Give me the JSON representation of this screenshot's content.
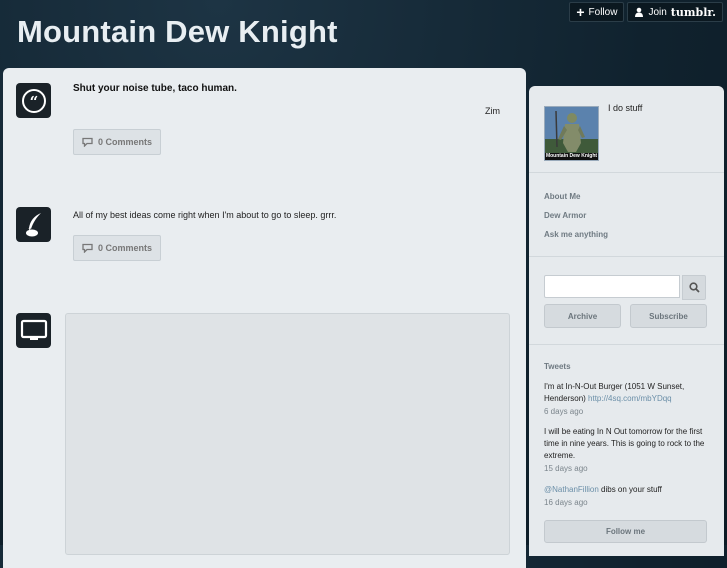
{
  "blog": {
    "title": "Mountain Dew Knight",
    "description": "I do stuff",
    "avatar_caption": "Mountain Dew Knight"
  },
  "tumblr_bar": {
    "follow_label": "Follow",
    "join_label": "Join",
    "brand": "tumblr."
  },
  "posts": [
    {
      "type": "quote",
      "icon": "quote-icon",
      "text": "Shut your noise tube, taco human.",
      "source": "Zim",
      "comments_label": "0 Comments"
    },
    {
      "type": "text",
      "icon": "quill-icon",
      "text": "All of my best ideas come right when I'm about to go to sleep. grrr.",
      "comments_label": "0 Comments"
    },
    {
      "type": "video",
      "icon": "monitor-icon"
    }
  ],
  "sidebar": {
    "links": [
      "About Me",
      "Dew Armor",
      "Ask me anything"
    ],
    "search": {
      "placeholder": "",
      "icon": "search-icon"
    },
    "archive_label": "Archive",
    "subscribe_label": "Subscribe",
    "tweets_heading": "Tweets",
    "tweets": [
      {
        "text": "I'm at In-N-Out Burger (1051 W Sunset, Henderson) ",
        "link": "http://4sq.com/mbYDqq",
        "time": "6 days ago"
      },
      {
        "text": "I will be eating In N Out tomorrow for the first time in nine years. This is going to rock to the extreme.",
        "time": "15 days ago"
      },
      {
        "mention": "@NathanFillion",
        "text": " dibs on your stuff",
        "time": "16 days ago"
      }
    ],
    "follow_me_label": "Follow me"
  }
}
